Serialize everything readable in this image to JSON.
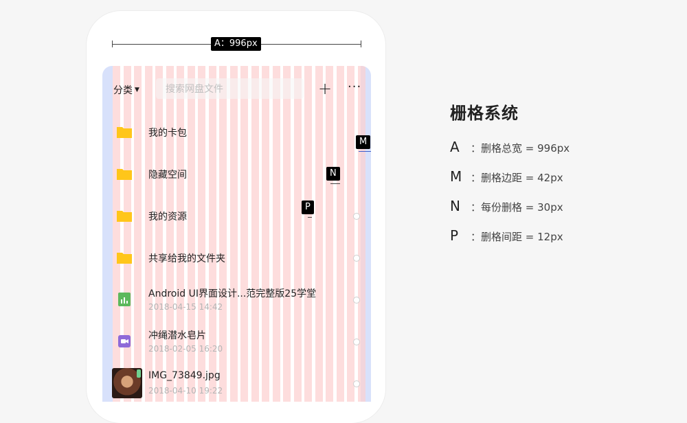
{
  "annotation": {
    "width_tag": "A：996px",
    "margin_tag": "M",
    "column_tag": "N",
    "gutter_tag": "P"
  },
  "grid": {
    "columns": 24,
    "column_color": "#fcd0d0",
    "margin_color": "#d8e1fb"
  },
  "app": {
    "category_label": "分类",
    "search_placeholder": "搜索网盘文件",
    "add_glyph": "+",
    "more_glyph": "···"
  },
  "files": [
    {
      "name": "我的卡包",
      "date": "",
      "time": "",
      "type": "folder",
      "selectable": false
    },
    {
      "name": "隐藏空间",
      "date": "",
      "time": "",
      "type": "folder",
      "selectable": false
    },
    {
      "name": "我的资源",
      "date": "",
      "time": "",
      "type": "folder",
      "selectable": true
    },
    {
      "name": "共享给我的文件夹",
      "date": "",
      "time": "",
      "type": "folder",
      "selectable": true
    },
    {
      "name": "Android UI界面设计...范完整版25学堂",
      "date": "2018-04-15",
      "time": "14:42",
      "type": "spreadsheet",
      "selectable": true
    },
    {
      "name": "冲绳潜水皂片",
      "date": "2018-02-05",
      "time": "16:20",
      "type": "video",
      "selectable": true
    },
    {
      "name": "IMG_73849.jpg",
      "date": "2018-04-10",
      "time": "19:22",
      "type": "image",
      "selectable": true
    }
  ],
  "info": {
    "title": "栅格系统",
    "items": [
      {
        "key": "A",
        "text": "：删格总宽 = 996px"
      },
      {
        "key": "M",
        "text": "：删格边距 = 42px"
      },
      {
        "key": "N",
        "text": "：每份删格 = 30px"
      },
      {
        "key": "P",
        "text": "：删格间距 = 12px"
      }
    ]
  },
  "colors": {
    "folder": "#ffc61a",
    "spreadsheet": "#5cb85c",
    "video": "#8e6ad8"
  }
}
